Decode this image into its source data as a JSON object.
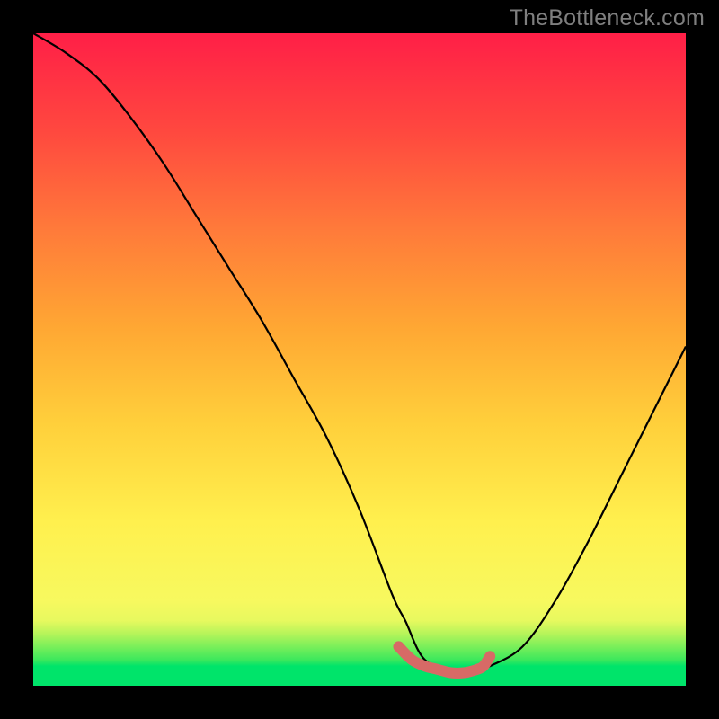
{
  "watermark": "TheBottleneck.com",
  "chart_data": {
    "type": "line",
    "title": "",
    "xlabel": "",
    "ylabel": "",
    "xlim": [
      0,
      100
    ],
    "ylim": [
      0,
      100
    ],
    "series": [
      {
        "name": "bottleneck-curve",
        "x": [
          0,
          5,
          10,
          15,
          20,
          25,
          30,
          35,
          40,
          45,
          50,
          55,
          57,
          60,
          65,
          67,
          70,
          75,
          80,
          85,
          90,
          95,
          100
        ],
        "values": [
          100,
          97,
          93,
          87,
          80,
          72,
          64,
          56,
          47,
          38,
          27,
          14,
          10,
          4,
          2,
          2,
          3,
          6,
          13,
          22,
          32,
          42,
          52
        ]
      },
      {
        "name": "optimal-range-highlight",
        "x": [
          56,
          58,
          60,
          62,
          64,
          66,
          68,
          69,
          70
        ],
        "values": [
          6,
          4,
          3,
          2.5,
          2,
          2,
          2.5,
          3,
          4.5
        ]
      }
    ]
  },
  "colors": {
    "curve": "#000000",
    "highlight": "#d76a66",
    "watermark": "#7f7f7f"
  }
}
